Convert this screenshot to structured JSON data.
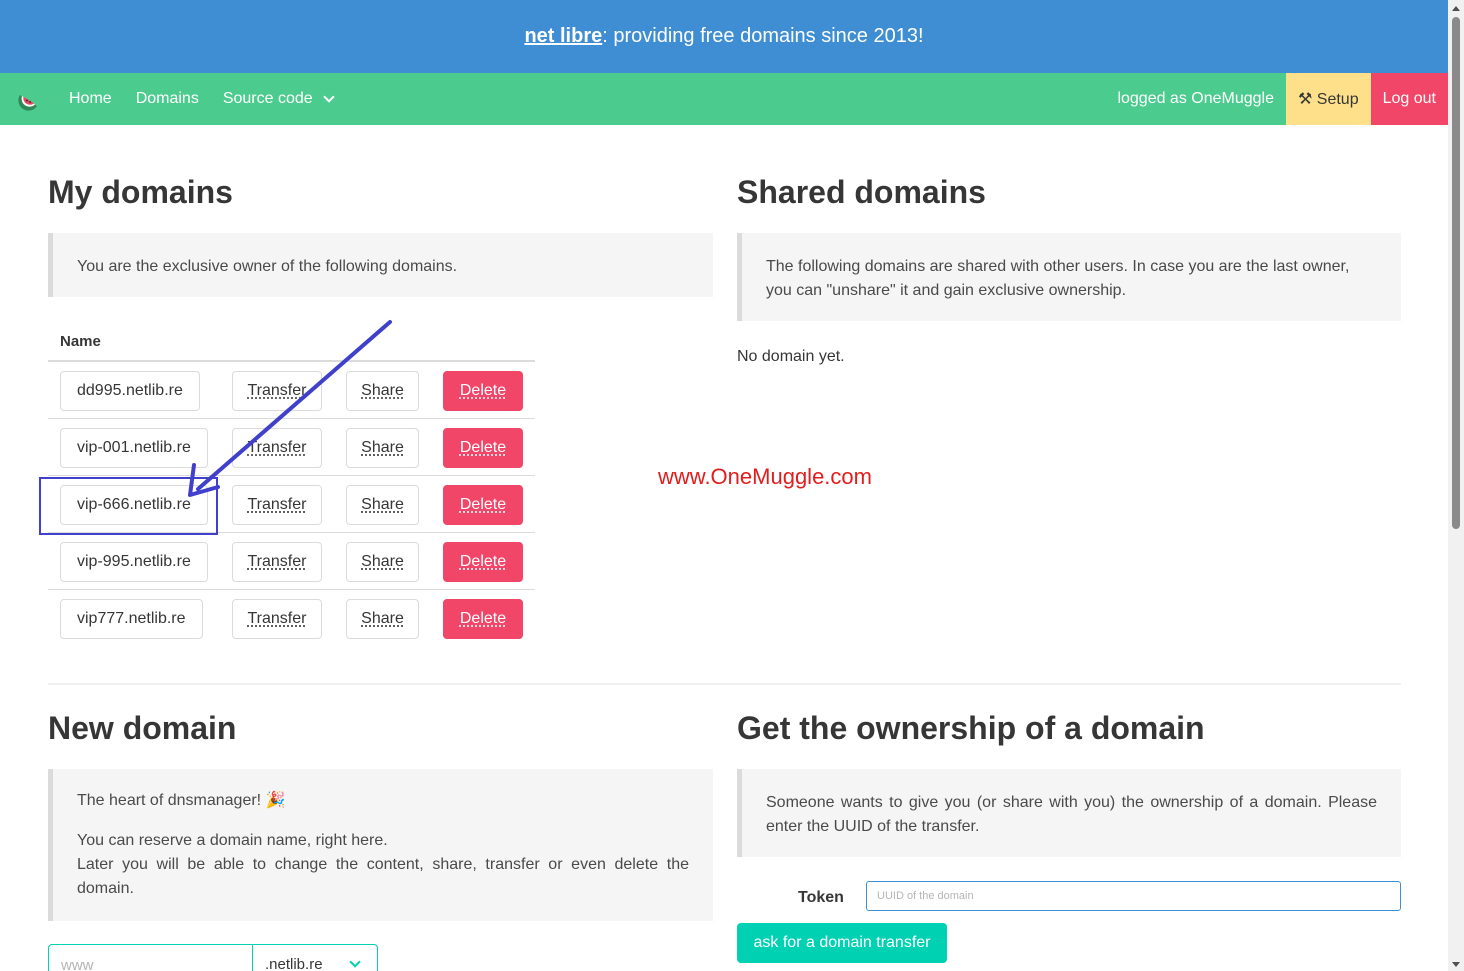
{
  "banner": {
    "brand": "net libre",
    "tagline": ": providing free domains since 2013!"
  },
  "navbar": {
    "logo_icon": "watermelon-icon",
    "items": [
      {
        "label": "Home"
      },
      {
        "label": "Domains"
      },
      {
        "label": "Source code"
      }
    ],
    "user_label": "logged as OneMuggle",
    "setup_label": "⚒ Setup",
    "logout_label": "Log out",
    "colors": {
      "banner": "#3f8ed3",
      "navbar": "#4ccb8e",
      "setup": "#ffe08a",
      "logout": "#f14668"
    }
  },
  "my_domains": {
    "title": "My domains",
    "notice": "You are the exclusive owner of the following domains.",
    "column_name": "Name",
    "rows": [
      {
        "name": "dd995.netlib.re",
        "transfer": "Transfer",
        "share": "Share",
        "delete": "Delete"
      },
      {
        "name": "vip-001.netlib.re",
        "transfer": "Transfer",
        "share": "Share",
        "delete": "Delete"
      },
      {
        "name": "vip-666.netlib.re",
        "transfer": "Transfer",
        "share": "Share",
        "delete": "Delete"
      },
      {
        "name": "vip-995.netlib.re",
        "transfer": "Transfer",
        "share": "Share",
        "delete": "Delete"
      },
      {
        "name": "vip777.netlib.re",
        "transfer": "Transfer",
        "share": "Share",
        "delete": "Delete"
      }
    ]
  },
  "shared_domains": {
    "title": "Shared domains",
    "notice": "The following domains are shared with other users. In case you are the last owner, you can \"unshare\" it and gain exclusive ownership.",
    "empty": "No domain yet."
  },
  "watermark": "www.OneMuggle.com",
  "new_domain": {
    "title": "New domain",
    "line1": "The heart of dnsmanager! 🎉",
    "line2": "You can reserve a domain name, right here.",
    "line3": "Later you will be able to change the content, share, transfer or even delete the domain.",
    "input_placeholder": "www",
    "tld_selected": ".netlib.re"
  },
  "ownership": {
    "title": "Get the ownership of a domain",
    "notice": "Someone wants to give you (or share with you) the ownership of a domain. Please enter the UUID of the transfer.",
    "token_label": "Token",
    "token_placeholder": "UUID of the domain",
    "button": "ask for a domain transfer"
  }
}
